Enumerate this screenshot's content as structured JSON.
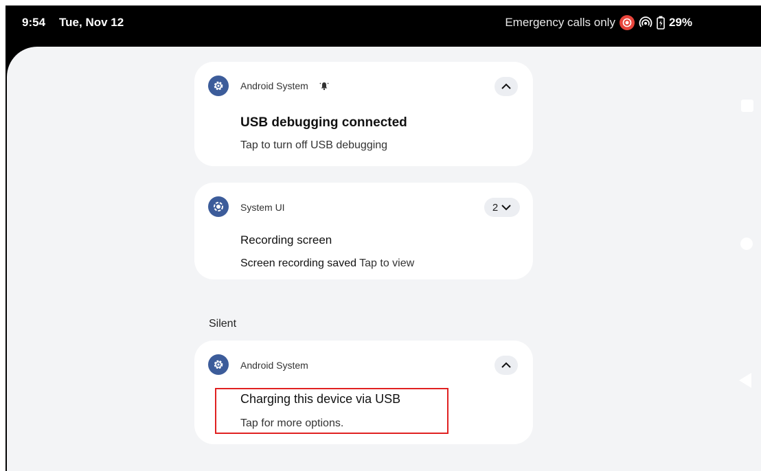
{
  "status_bar": {
    "time": "9:54",
    "date": "Tue, Nov 12",
    "network": "Emergency calls only",
    "battery": "29%",
    "icons": [
      "screen-record-icon",
      "hotspot-icon",
      "battery-charging-icon"
    ]
  },
  "notifications": [
    {
      "app": "Android System",
      "icon": "settings-gear-icon",
      "title": "USB debugging connected",
      "text": "Tap to turn off USB debugging",
      "control": "collapse"
    },
    {
      "app": "System UI",
      "icon": "screen-record-icon",
      "title": "Recording screen",
      "text_bold": "Screen recording saved",
      "text": "Tap to view",
      "count": "2",
      "control": "expand"
    }
  ],
  "silent_section": {
    "label": "Silent",
    "notifications": [
      {
        "app": "Android System",
        "icon": "settings-gear-icon",
        "title": "Charging this device via USB",
        "text": "Tap for more options.",
        "control": "collapse"
      }
    ]
  },
  "colors": {
    "app_icon_bg": "#3c5c9a",
    "shade_bg": "#f3f4f6",
    "highlight": "#e02020",
    "record_red": "#e8453c"
  }
}
